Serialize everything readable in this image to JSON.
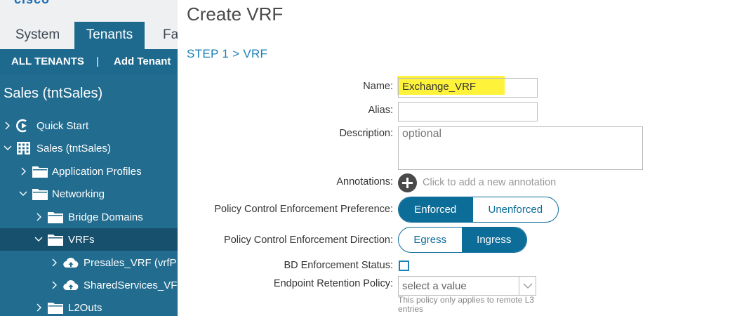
{
  "brand": {
    "logo_text": "cisco"
  },
  "top_tabs": [
    {
      "label": "System"
    },
    {
      "label": "Tenants"
    },
    {
      "label": "Fa"
    }
  ],
  "subnav": {
    "all_tenants": "ALL TENANTS",
    "separator": "|",
    "add_tenant": "Add Tenant"
  },
  "tree": {
    "tenant_title": "Sales (tntSales)",
    "nodes": [
      {
        "label": "Quick Start",
        "icon": "quick-start-icon",
        "expanded": false
      },
      {
        "label": "Sales (tntSales)",
        "icon": "tenant-grid-icon",
        "expanded": true
      },
      {
        "label": "Application Profiles",
        "icon": "folder-icon",
        "expanded": false
      },
      {
        "label": "Networking",
        "icon": "folder-icon",
        "expanded": true
      },
      {
        "label": "Bridge Domains",
        "icon": "folder-icon",
        "expanded": false
      },
      {
        "label": "VRFs",
        "icon": "folder-icon",
        "expanded": true,
        "selected": true
      },
      {
        "label": "Presales_VRF (vrfP",
        "icon": "cloud-icon",
        "expanded": false
      },
      {
        "label": "SharedServices_VF",
        "icon": "cloud-icon",
        "expanded": false
      },
      {
        "label": "L2Outs",
        "icon": "folder-icon",
        "expanded": false
      }
    ]
  },
  "form": {
    "title": "Create VRF",
    "step": "STEP 1 > VRF",
    "name": {
      "label": "Name:",
      "value": "Exchange_VRF"
    },
    "alias": {
      "label": "Alias:",
      "value": ""
    },
    "description": {
      "label": "Description:",
      "placeholder": "optional"
    },
    "annotations": {
      "label": "Annotations:",
      "add_text": "Click to add a new annotation"
    },
    "pce_preference": {
      "label": "Policy Control Enforcement Preference:",
      "options": [
        "Enforced",
        "Unenforced"
      ],
      "selected": "Enforced"
    },
    "pce_direction": {
      "label": "Policy Control Enforcement Direction:",
      "options": [
        "Egress",
        "Ingress"
      ],
      "selected": "Ingress"
    },
    "bd_enforcement": {
      "label": "BD Enforcement Status:",
      "checked": false
    },
    "endpoint_retention": {
      "label": "Endpoint Retention Policy:",
      "placeholder": "select a value",
      "hint": "This policy only applies to remote L3 entries"
    }
  },
  "colors": {
    "nav_blue": "#1e6a8e",
    "tree_bg": "#226c8f",
    "selected_row": "#17506d",
    "accent": "#0d6d99",
    "highlight": "#fff23a"
  }
}
